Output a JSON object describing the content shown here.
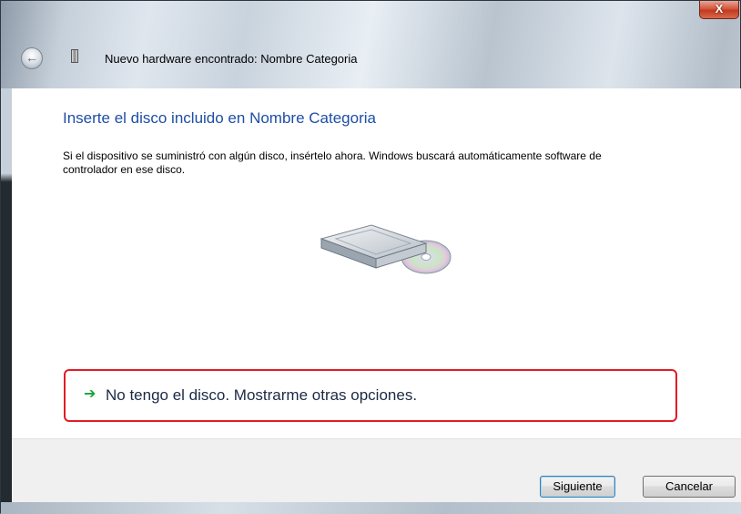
{
  "window": {
    "title": "Nuevo hardware encontrado: Nombre Categoria",
    "close_label": "X"
  },
  "icons": {
    "back": "back-arrow-icon",
    "hardware": "hardware-device-icon",
    "disc": "disc-drive-icon",
    "option_arrow": "green-arrow-icon"
  },
  "content": {
    "heading": "Inserte el disco incluido en Nombre Categoria",
    "description": "Si el dispositivo se suministró con algún disco, insértelo ahora. Windows buscará automáticamente software de controlador en ese disco.",
    "option_link": "No tengo el disco. Mostrarme otras opciones."
  },
  "buttons": {
    "next_label": "Siguiente",
    "cancel_label": "Cancelar"
  },
  "colors": {
    "heading": "#1e4ea6",
    "highlight": "#e21c26",
    "arrow": "#16a33a"
  }
}
